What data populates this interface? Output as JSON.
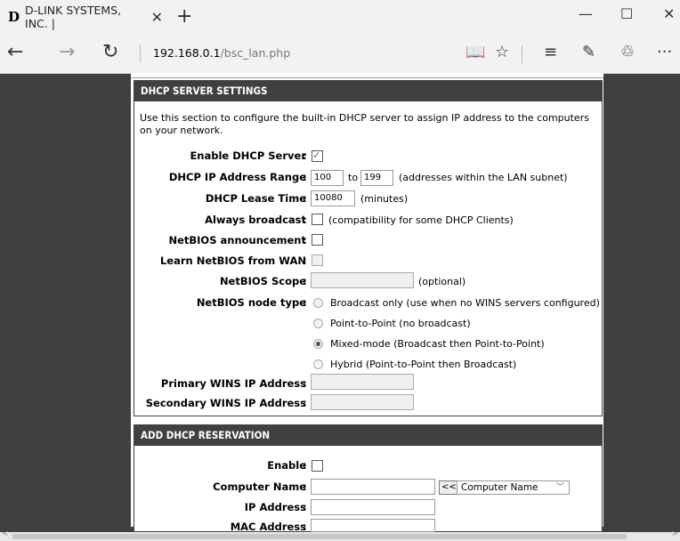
{
  "browser": {
    "tab_favicon": "D",
    "tab_title": "D-LINK SYSTEMS, INC. |",
    "tab_close": "✕",
    "new_tab": "+",
    "window_minimize": "—",
    "window_maximize": "☐",
    "window_close": "✕",
    "nav_back": "←",
    "nav_forward": "→",
    "nav_refresh": "↻",
    "url_host": "192.168.0.1",
    "url_path": "/bsc_lan.php",
    "tool_reading": "📖",
    "tool_favorite": "☆",
    "tool_hub": "≡",
    "tool_note": "✎",
    "tool_share": "♲",
    "tool_more": "···"
  },
  "dhcp_server": {
    "header": "DHCP SERVER SETTINGS",
    "intro": "Use this section to configure the built-in DHCP server to assign IP address to the computers on your network.",
    "enable_label": "Enable DHCP Server",
    "enable_checked": true,
    "range_label": "DHCP IP Address Range",
    "range_start": "100",
    "range_to": "to",
    "range_end": "199",
    "range_note": "(addresses within the LAN subnet)",
    "lease_label": "DHCP Lease Time",
    "lease_value": "10080",
    "lease_unit": "(minutes)",
    "broadcast_label": "Always broadcast",
    "broadcast_note": "(compatibility for some DHCP Clients)",
    "netbios_announce_label": "NetBIOS announcement",
    "netbios_wan_label": "Learn NetBIOS from WAN",
    "netbios_scope_label": "NetBIOS Scope",
    "netbios_scope_value": "",
    "netbios_scope_note": "(optional)",
    "netbios_node_label": "NetBIOS node type",
    "node_options": [
      {
        "label": "Broadcast only (use when no WINS servers configured)",
        "checked": false
      },
      {
        "label": "Point-to-Point (no broadcast)",
        "checked": false
      },
      {
        "label": "Mixed-mode (Broadcast then Point-to-Point)",
        "checked": true
      },
      {
        "label": "Hybrid (Point-to-Point then Broadcast)",
        "checked": false
      }
    ],
    "primary_wins_label": "Primary WINS IP Address",
    "secondary_wins_label": "Secondary WINS IP Address",
    "primary_wins_value": "",
    "secondary_wins_value": ""
  },
  "reservation": {
    "header": "ADD DHCP RESERVATION",
    "enable_label": "Enable",
    "computer_name_label": "Computer Name",
    "computer_name_value": "",
    "copy_button": "<<",
    "computer_select": "Computer Name",
    "ip_label": "IP Address",
    "ip_value": "",
    "mac_label": "MAC Address",
    "mac_value": ""
  },
  "colon": ":"
}
